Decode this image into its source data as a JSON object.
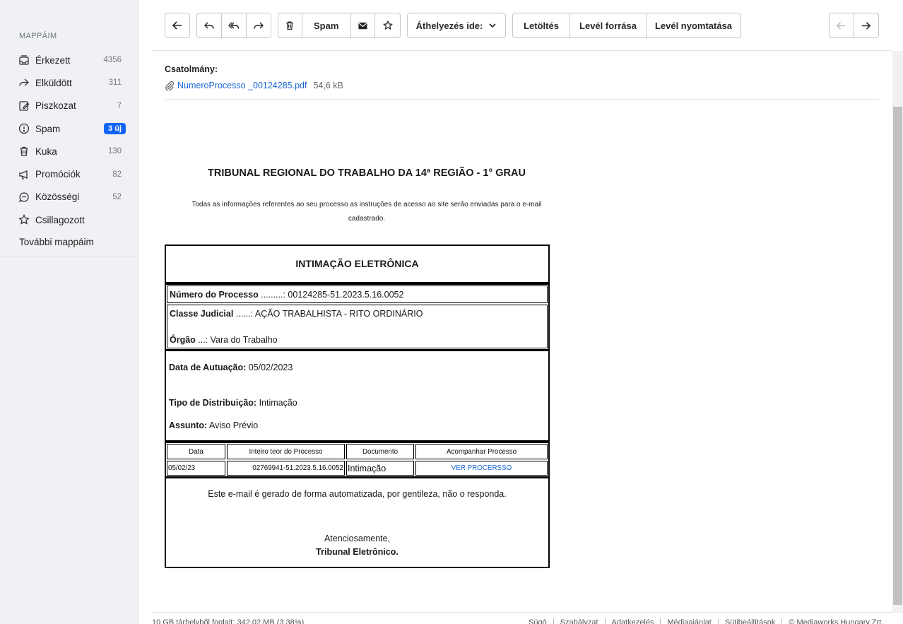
{
  "sidebar": {
    "title": "MAPPÁIM",
    "items": [
      {
        "label": "Érkezett",
        "count": "4356",
        "icon": "inbox-icon"
      },
      {
        "label": "Elküldött",
        "count": "311",
        "icon": "sent-icon"
      },
      {
        "label": "Piszkozat",
        "count": "7",
        "icon": "draft-icon"
      },
      {
        "label": "Spam",
        "badge": "3 új",
        "icon": "spam-icon"
      },
      {
        "label": "Kuka",
        "count": "130",
        "icon": "trash-icon"
      },
      {
        "label": "Promóciók",
        "count": "82",
        "icon": "megaphone-icon"
      },
      {
        "label": "Közösségi",
        "count": "52",
        "icon": "chat-icon"
      },
      {
        "label": "Csillagozott",
        "icon": "star-icon"
      }
    ],
    "more": "További mappáim",
    "badge_color": "#1064f5"
  },
  "toolbar": {
    "spam": "Spam",
    "move_to": "Áthelyezés ide:",
    "download": "Letöltés",
    "source": "Levél forrása",
    "print": "Levél nyomtatása"
  },
  "attachment": {
    "title": "Csatolmány:",
    "filename": "NumeroProcesso _00124285.pdf",
    "size": "54,6 kB",
    "link_color": "#1a66d6"
  },
  "email": {
    "title": "TRIBUNAL REGIONAL DO TRABALHO DA 14ª REGIÃO - 1° GRAU",
    "subtitle": "Todas as informações referentes ao seu processo as instruções de acesso ao site serão enviadas para o e-mail cadastrado.",
    "heading": "INTIMAÇÃO ELETRÔNICA",
    "processo_label": "Número do Processo",
    "processo_value": " .........: 00124285-51.2023.5.16.0052",
    "classe_label": "Classe Judicial",
    "classe_value": " ......: AÇÃO TRABALHISTA - RITO ORDINÁRIO",
    "orgao_label": "Órgão",
    "orgao_value": " ...: Vara do Trabalho",
    "data_label": "Data de Autuação:",
    "data_value": " 05/02/2023",
    "tipo_label": "Tipo de Distribuição:",
    "tipo_value": " Intimação",
    "assunto_label": "Assunto:",
    "assunto_value": " Aviso Prévio",
    "table": {
      "headers": [
        "Data",
        "Inteiro teor do Processo",
        "Documento",
        "Acompanhar Processo"
      ],
      "row": [
        "05/02/23",
        "02769941-51.2023.5.16.0052",
        "Intimação",
        "VER PROCERSSO"
      ]
    },
    "auto_msg": "Este e-mail é gerado de forma automatizada, por gentileza, não o responda.",
    "closing": "Atenciosamente,",
    "signature": "Tribunal Eletrônico."
  },
  "footer": {
    "quota": "10 GB tárhelyből foglalt: 342,02 MB (3,38%)",
    "links": [
      "Súgó",
      "Szabályzat",
      "Adatkezelés",
      "Médiaajánlat",
      "Sütibeállítások",
      "© Mediaworks Hungary Zrt."
    ]
  }
}
